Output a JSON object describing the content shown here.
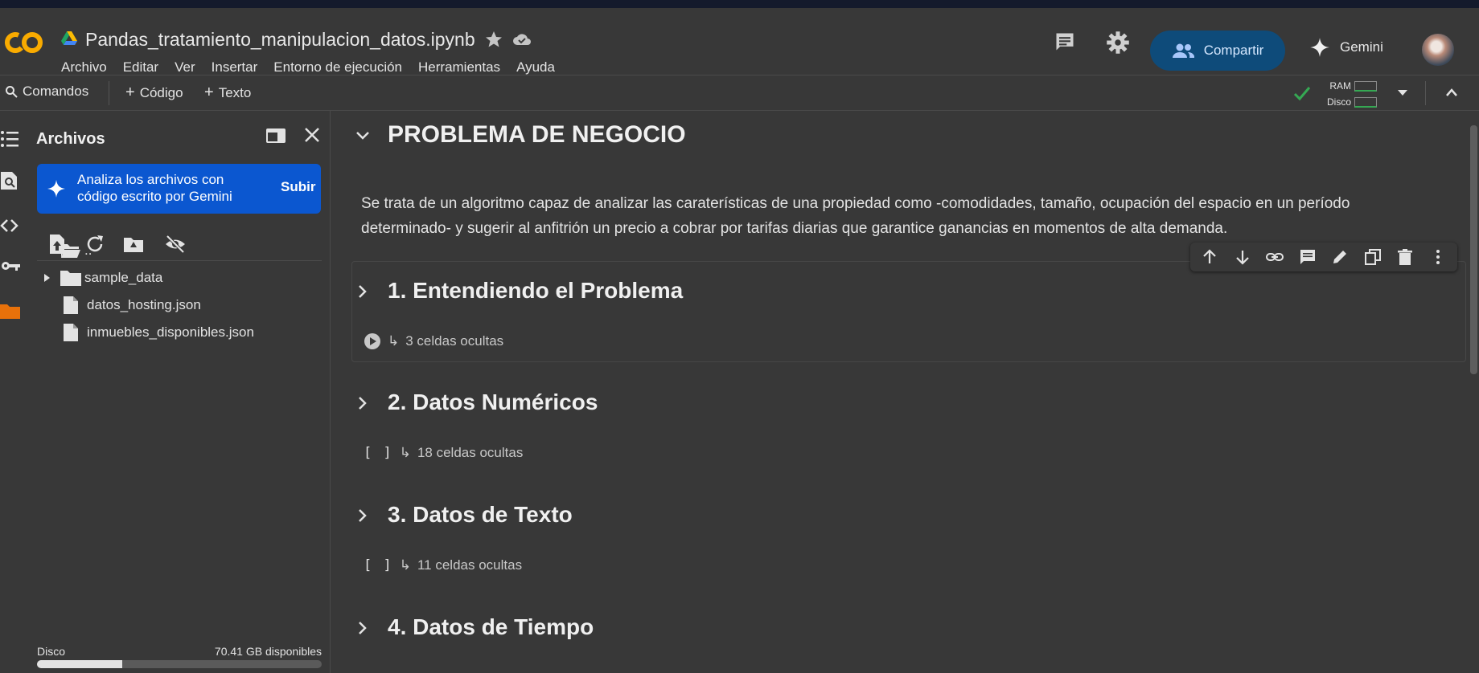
{
  "header": {
    "notebook_title": "Pandas_tratamiento_manipulacion_datos.ipynb",
    "menus": [
      "Archivo",
      "Editar",
      "Ver",
      "Insertar",
      "Entorno de ejecución",
      "Herramientas",
      "Ayuda"
    ],
    "share_label": "Compartir",
    "gemini_label": "Gemini"
  },
  "toolbar": {
    "commands_label": "Comandos",
    "code_label": "Código",
    "text_label": "Texto",
    "ram_label": "RAM",
    "disk_label": "Disco"
  },
  "files_panel": {
    "title": "Archivos",
    "gemini_card_text": "Analiza los archivos con código escrito por Gemini",
    "upload_label": "Subir",
    "items": [
      {
        "name": "..",
        "type": "folder-open"
      },
      {
        "name": "sample_data",
        "type": "folder"
      },
      {
        "name": "datos_hosting.json",
        "type": "file"
      },
      {
        "name": "inmuebles_disponibles.json",
        "type": "file"
      }
    ],
    "disk_label": "Disco",
    "disk_free": "70.41 GB disponibles",
    "disk_used_fraction": 0.3
  },
  "notebook": {
    "main_heading": "PROBLEMA DE NEGOCIO",
    "paragraph": "Se trata de un algoritmo capaz de analizar las caraterísticas de una propiedad como -comodidades, tamaño, ocupación del espacio en un período determinado- y sugerir al anfitrión un precio a cobrar por tarifas diarias que garantice ganancias en momentos de alta demanda.",
    "sections": [
      {
        "title": "1. Entendiendo el Problema",
        "hidden": "3 celdas ocultas"
      },
      {
        "title": "2. Datos Numéricos",
        "hidden": "18 celdas ocultas"
      },
      {
        "title": "3. Datos de Texto",
        "hidden": "11 celdas ocultas"
      },
      {
        "title": "4. Datos de Tiempo",
        "hidden": ""
      }
    ],
    "bracket_label": "[ ]",
    "hidden_arrow": "↳"
  },
  "colors": {
    "share_bg": "#0e4b7a",
    "gemini_card_bg": "#0b57d0",
    "logo_orange": "#f9ab00",
    "folder_orange": "#e8710a",
    "status_green": "#35a853"
  }
}
